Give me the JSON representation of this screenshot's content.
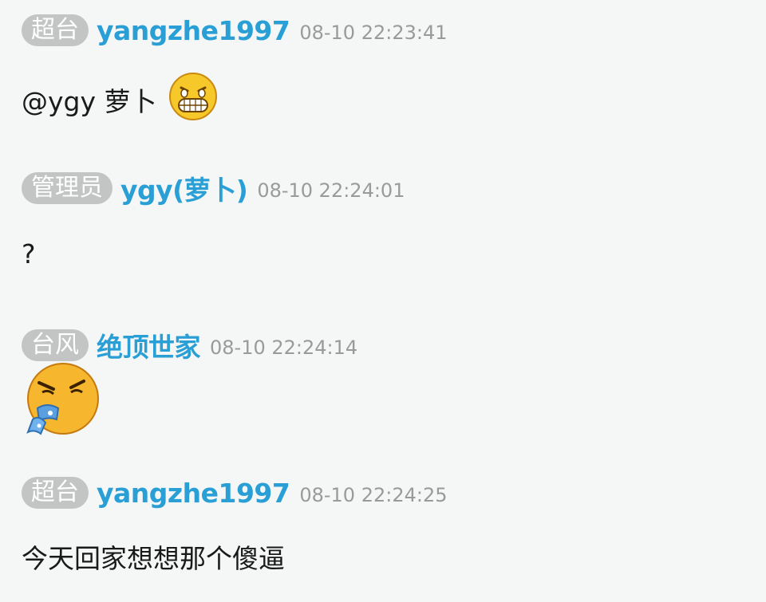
{
  "messages": [
    {
      "badge": "超台",
      "username": "yangzhe1997",
      "timestamp": "08-10 22:23:41",
      "text": "@ygy 萝卜",
      "emoji": "grin-emoji-icon"
    },
    {
      "badge": "管理员",
      "username": "ygy(萝卜)",
      "timestamp": "08-10 22:24:01",
      "text": "?"
    },
    {
      "badge": "台风",
      "username": "绝顶世家",
      "timestamp": "08-10 22:24:14",
      "emoji": "vomit-emoji-icon"
    },
    {
      "badge": "超台",
      "username": "yangzhe1997",
      "timestamp": "08-10 22:24:25",
      "text": "今天回家想想那个傻逼"
    }
  ]
}
